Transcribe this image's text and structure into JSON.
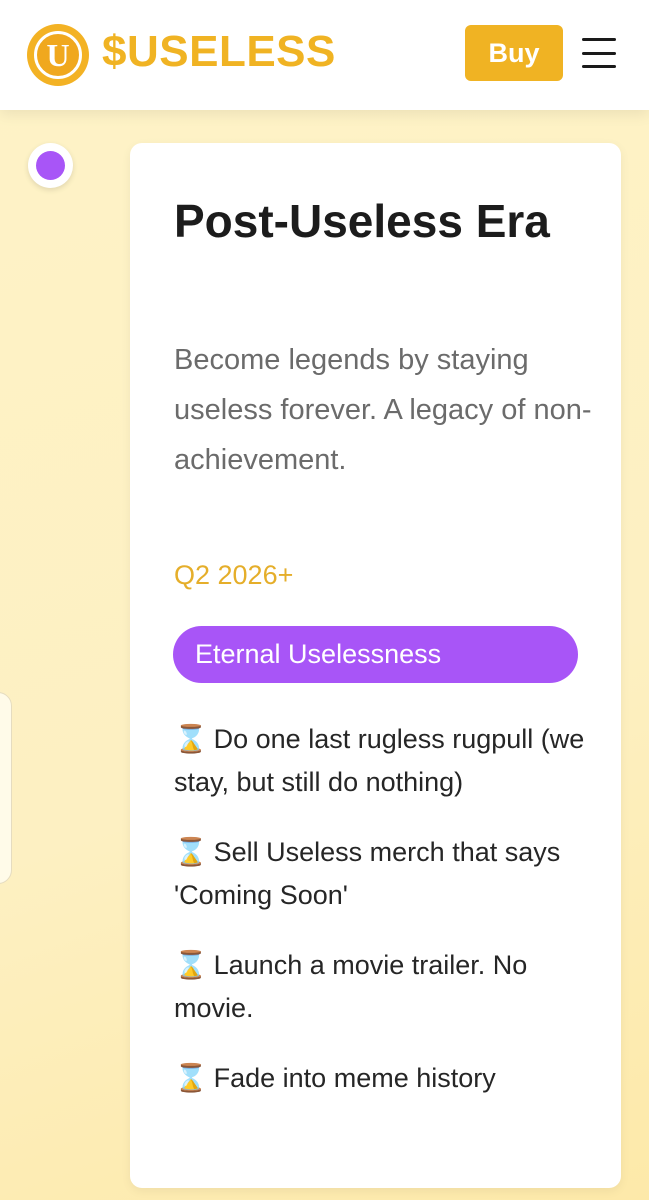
{
  "header": {
    "logo_letter": "U",
    "brand": "$USELESS",
    "buy_label": "Buy",
    "menu_icon": "hamburger-icon"
  },
  "colors": {
    "brand_gold": "#f0b323",
    "accent_purple": "#a855f7",
    "background": "#fdf0c4"
  },
  "phase": {
    "title": "Post-Useless Era",
    "description": "Become legends by staying useless forever. A legacy of non-achievement.",
    "date": "Q2 2026+",
    "tag": "Eternal Uselessness",
    "task_icon": "hourglass-icon",
    "task_glyph": "⌛",
    "tasks": [
      "Do one last rugless rugpull (we stay, but still do nothing)",
      "Sell Useless merch that says 'Coming Soon'",
      "Launch a movie trailer. No movie.",
      "Fade into meme history"
    ]
  }
}
